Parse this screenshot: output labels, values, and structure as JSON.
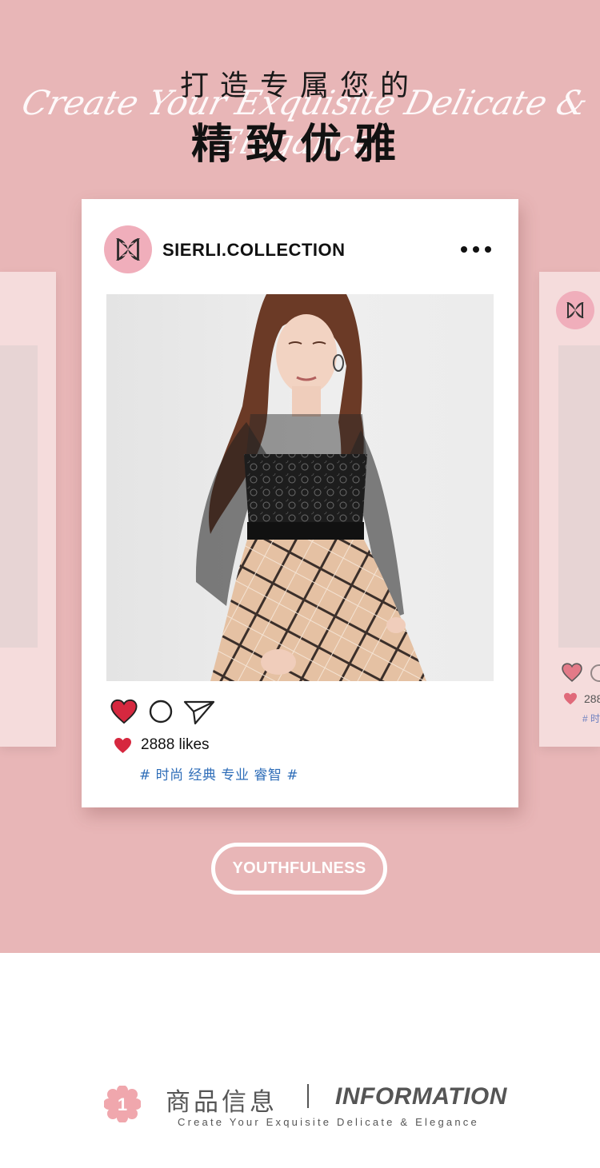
{
  "header": {
    "line1": "打造专属您的",
    "line2": "精致优雅",
    "script": "Create Your Exquisite Delicate & Elegance"
  },
  "post": {
    "username": "SIERLI.COLLECTION",
    "likes_label": "2888 likes",
    "hashtags": "# 时尚 经典 专业 睿智 #",
    "icons": [
      "logo-icon",
      "more-icon",
      "heart-icon",
      "comment-icon",
      "send-icon"
    ]
  },
  "side_card_right": {
    "likes_partial": "288",
    "tag_partial": "# 时"
  },
  "button": {
    "label": "YOUTHFULNESS"
  },
  "info_section": {
    "badge_number": "1",
    "title_zh": "商品信息",
    "title_en": "INFORMATION",
    "subtitle": "Create Your Exquisite Delicate & Elegance"
  },
  "colors": {
    "background_pink": "#e8b6b7",
    "side_card_pink": "#f5dcdc",
    "avatar_pink": "#f0aebb",
    "heart_red": "#d6283f",
    "hashtag_blue": "#2e6db8",
    "flower_pink": "#f0a7ad"
  }
}
